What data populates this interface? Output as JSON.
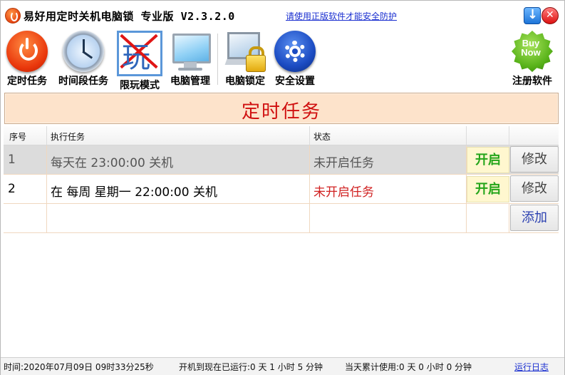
{
  "window": {
    "title": "易好用定时关机电脑锁 专业版 V2.3.2.0",
    "notice_link": "请使用正版软件才能安全防护"
  },
  "toolbar": {
    "items": [
      {
        "label": "定时任务",
        "icon": "power-icon"
      },
      {
        "label": "时间段任务",
        "icon": "clock-icon"
      },
      {
        "label": "限玩模式",
        "icon": "limit-play-icon"
      },
      {
        "label": "电脑管理",
        "icon": "monitor-icon"
      },
      {
        "label": "电脑锁定",
        "icon": "computer-lock-icon"
      },
      {
        "label": "安全设置",
        "icon": "gear-icon"
      }
    ],
    "register": {
      "label": "注册软件",
      "icon": "buy-now-badge-icon",
      "badge_line1": "Buy",
      "badge_line2": "Now"
    }
  },
  "banner": {
    "title": "定时任务"
  },
  "table": {
    "headers": [
      "序号",
      "执行任务",
      "状态",
      "",
      ""
    ],
    "rows": [
      {
        "num": "1",
        "task": "每天在 23:00:00 关机",
        "state": "未开启任务",
        "state_color": "#555555",
        "action": "开启",
        "edit": "修改",
        "selected": true
      },
      {
        "num": "2",
        "task": "在 每周 星期一 22:00:00 关机",
        "state": "未开启任务",
        "state_color": "#d02020",
        "action": "开启",
        "edit": "修改",
        "selected": false
      }
    ],
    "add_label": "添加"
  },
  "status": {
    "time": "时间:2020年07月09日 09时33分25秒",
    "uptime": "开机到现在已运行:0 天 1 小时 5 分钟",
    "today_usage": "当天累计使用:0 天 0 小时 0 分钟",
    "log_link": "运行日志"
  },
  "colors": {
    "banner_bg": "#fde3cb",
    "banner_text": "#d01010",
    "enable_text": "#24a51a",
    "link": "#1a2fd0"
  }
}
